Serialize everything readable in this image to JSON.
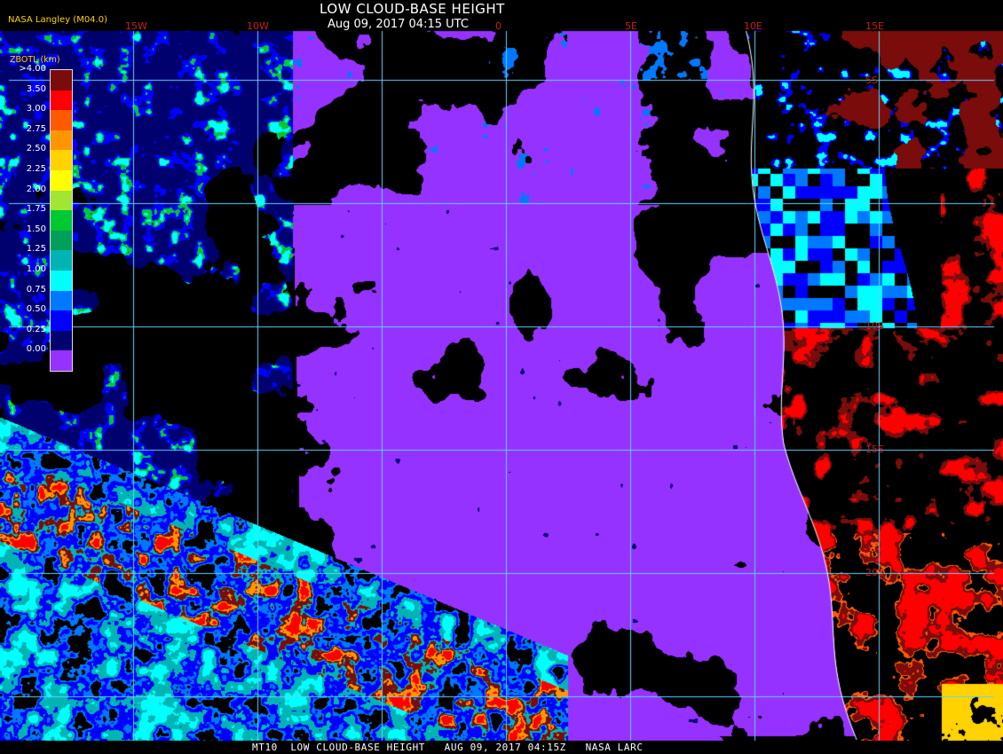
{
  "header": {
    "title": "LOW CLOUD-BASE HEIGHT",
    "datetime": "Aug 09, 2017 04:15 UTC",
    "credit": "NASA Langley (M04.0)"
  },
  "footer": {
    "text": "MT10  LOW CLOUD-BASE HEIGHT   AUG 09, 2017 04:15Z   NASA LARC"
  },
  "legend": {
    "title": "ZBOTL (km)",
    "labels": [
      ">4.00",
      "3.50",
      "3.00",
      "2.75",
      "2.50",
      "2.25",
      "2.00",
      "1.75",
      "1.50",
      "1.25",
      "1.00",
      "0.75",
      "0.50",
      "0.25",
      "0.00"
    ],
    "colors": [
      "#7a0c0c",
      "#ff0000",
      "#ff5a00",
      "#ff9600",
      "#ffd200",
      "#ffff00",
      "#a0e632",
      "#00c832",
      "#00a05a",
      "#00b4b4",
      "#00ffff",
      "#0078ff",
      "#0000ff",
      "#00006e",
      "#9632ff"
    ]
  },
  "map": {
    "lon_labels": [
      "15W",
      "10W",
      "0",
      "5E",
      "10E",
      "15E"
    ],
    "lat_labels": [
      "5S",
      "10S",
      "15S",
      "20S"
    ],
    "colors": {
      "background": "#000000",
      "grid": "#5fd4ff",
      "coastline": "#ffffff",
      "grid_label": "#c81e1e"
    }
  }
}
